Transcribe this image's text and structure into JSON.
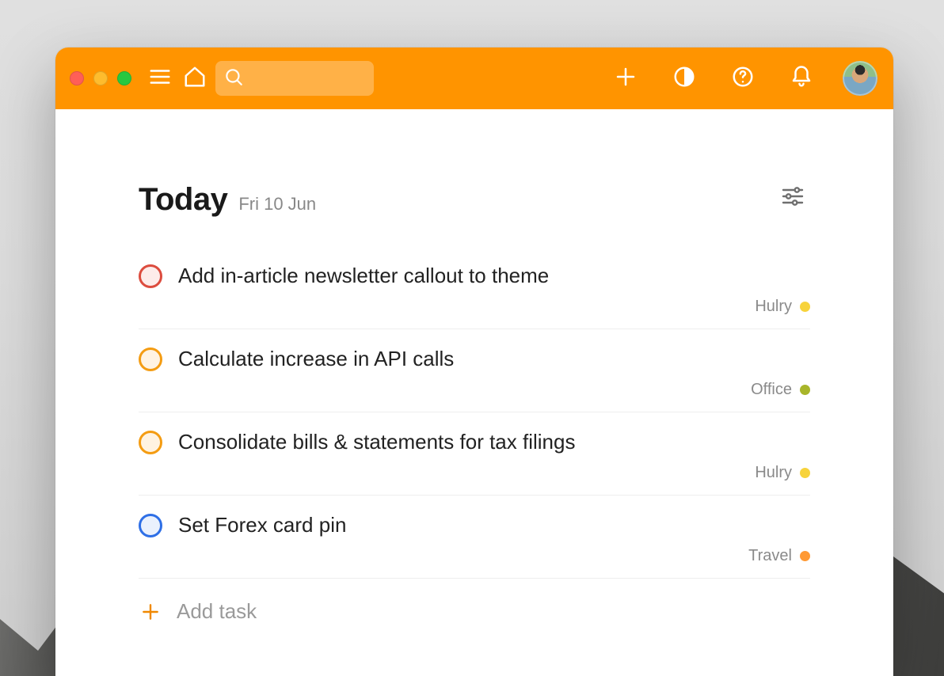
{
  "colors": {
    "brand": "#FF9400",
    "priority1": "#dc4c3e",
    "priority2": "#f49c12",
    "priorityBlue": "#2E6FE6",
    "projectHulry": "#f7d33b",
    "projectOffice": "#a8b52a",
    "projectTravel": "#ff9933"
  },
  "header": {
    "title": "Today",
    "date": "Fri 10 Jun"
  },
  "search": {
    "placeholder": ""
  },
  "addTask": {
    "label": "Add task"
  },
  "tasks": [
    {
      "title": "Add in-article newsletter callout to theme",
      "priorityClass": "p1",
      "project": {
        "name": "Hulry",
        "color": "#f7d33b"
      }
    },
    {
      "title": "Calculate increase in API calls",
      "priorityClass": "p2",
      "project": {
        "name": "Office",
        "color": "#a8b52a"
      }
    },
    {
      "title": "Consolidate bills & statements for tax filings",
      "priorityClass": "p3",
      "project": {
        "name": "Hulry",
        "color": "#f7d33b"
      }
    },
    {
      "title": "Set Forex card pin",
      "priorityClass": "p4",
      "project": {
        "name": "Travel",
        "color": "#ff9933"
      }
    }
  ]
}
